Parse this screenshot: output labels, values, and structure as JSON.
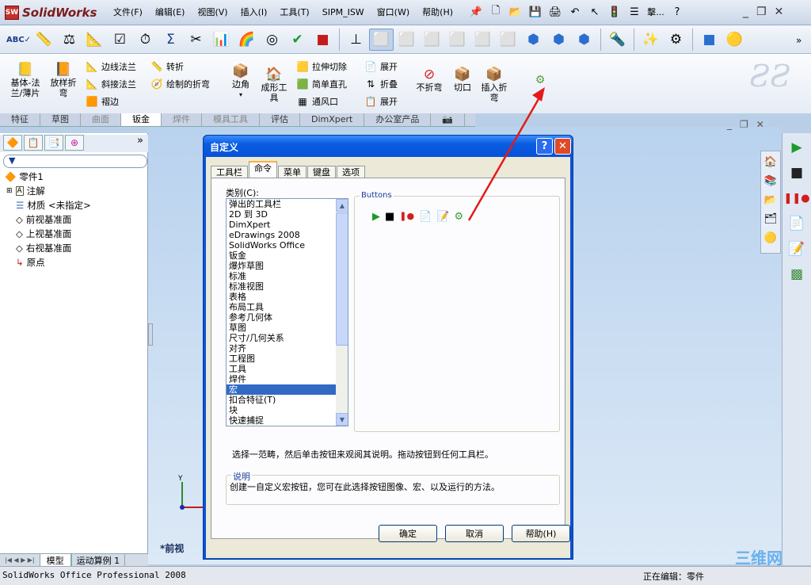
{
  "app": {
    "name": "SolidWorks",
    "logo_text": "SW"
  },
  "menu": [
    "文件(F)",
    "编辑(E)",
    "视图(V)",
    "插入(I)",
    "工具(T)",
    "SIPM_ISW",
    "窗口(W)",
    "帮助(H)"
  ],
  "quick_access": [
    "pin-icon",
    "new-icon",
    "open-icon",
    "save-icon",
    "print-icon",
    "undo-icon",
    "select-icon",
    "rebuild-icon",
    "options-icon",
    "ellipsis-icon",
    "help-icon"
  ],
  "quick_more": "擊...",
  "sheetmetal_ribbon": {
    "base_flange": "基体-法\n兰/薄片",
    "lofted_bend": "放样折\n弯",
    "edge_flange": "边线法兰",
    "miter_flange": "斜接法兰",
    "hem": "褶边",
    "jog": "转折",
    "sketched_bend": "绘制的折弯",
    "corner": "边角",
    "forming_tool": "成形工\n具",
    "extruded_cut": "拉伸切除",
    "simple_hole": "简单直孔",
    "vent": "通风口",
    "unfold": "展开",
    "fold": "折叠",
    "flatten": "展开",
    "no_bends": "不折弯",
    "rip": "切口",
    "insert_bends": "插入折\n弯"
  },
  "command_tabs": [
    {
      "label": "特征",
      "state": "normal"
    },
    {
      "label": "草图",
      "state": "normal"
    },
    {
      "label": "曲面",
      "state": "disabled"
    },
    {
      "label": "钣金",
      "state": "active"
    },
    {
      "label": "焊件",
      "state": "disabled"
    },
    {
      "label": "模具工具",
      "state": "disabled"
    },
    {
      "label": "评估",
      "state": "normal"
    },
    {
      "label": "DimXpert",
      "state": "normal"
    },
    {
      "label": "办公室产品",
      "state": "normal"
    }
  ],
  "feature_tree": {
    "part": "零件1",
    "items": [
      "注解",
      "材质 <未指定>",
      "前视基准面",
      "上视基准面",
      "右视基准面",
      "原点"
    ]
  },
  "bottom_tabs": [
    "模型",
    "运动算例 1"
  ],
  "view_label": "*前视",
  "axis_label": "Y",
  "status": {
    "left": "SolidWorks Office Professional 2008",
    "right": "正在编辑：零件"
  },
  "dialog": {
    "title": "自定义",
    "help_btn": "?",
    "tabs": [
      "工具栏",
      "命令",
      "菜单",
      "键盘",
      "选项"
    ],
    "active_tab": 1,
    "category_label": "类别(C):",
    "categories": [
      "弹出的工具栏",
      "2D 到 3D",
      "DimXpert",
      "eDrawings 2008",
      "SolidWorks Office",
      "钣金",
      "爆炸草图",
      "标准",
      "标准视图",
      "表格",
      "布局工具",
      "参考几何体",
      "草图",
      "尺寸/几何关系",
      "对齐",
      "工程图",
      "工具",
      "焊件",
      "宏",
      "扣合特征(T)",
      "块",
      "快速捕捉"
    ],
    "selected_category": "宏",
    "buttons_label": "Buttons",
    "hint": "选择一范畴，然后单击按钮来观阅其说明。拖动按钮到任何工具栏。",
    "description_label": "说明",
    "description": "创建一自定义宏按钮，您可在此选择按钮图像、宏、以及运行的方法。",
    "ok": "确定",
    "cancel": "取消",
    "help": "帮助(H)"
  },
  "watermark": "三维网"
}
